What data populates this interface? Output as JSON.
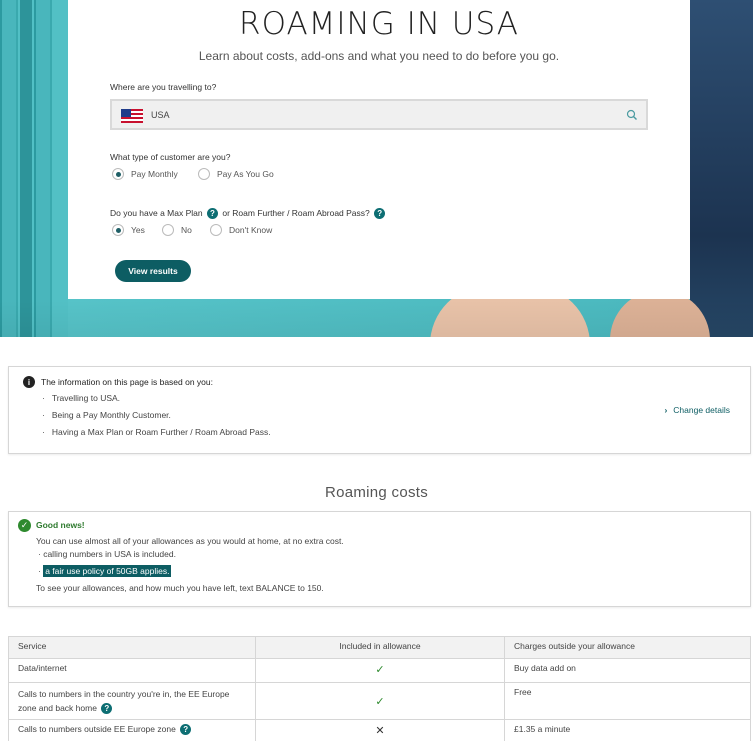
{
  "header": {
    "title": "ROAMING IN USA",
    "subtitle": "Learn about costs, add-ons and what you need to do before you go."
  },
  "form": {
    "destination_question": "Where are you travelling to?",
    "destination_value": "USA",
    "customer_question": "What type of customer are you?",
    "customer_options": [
      "Pay Monthly",
      "Pay As You Go"
    ],
    "customer_selected": "Pay Monthly",
    "plan_question_part1": "Do you have a Max Plan",
    "plan_question_part2": "or Roam Further / Roam Abroad Pass?",
    "plan_options": [
      "Yes",
      "No",
      "Don't Know"
    ],
    "plan_selected": "Yes",
    "view_results": "View results"
  },
  "info": {
    "heading": "The information on this page is based on you:",
    "items": [
      "Travelling to USA.",
      "Being a Pay Monthly Customer.",
      "Having a Max Plan or Roam Further / Roam Abroad Pass."
    ],
    "change_details": "Change details"
  },
  "roaming": {
    "title": "Roaming costs",
    "good_news": "Good news!",
    "line1": "You can use almost all of your allowances as you would at home, at no extra cost.",
    "bullet1": "calling numbers in USA is included.",
    "bullet2": "a fair use policy of 50GB applies.",
    "line2": "To see your allowances, and how much you have left, text BALANCE to 150."
  },
  "table": {
    "headers": [
      "Service",
      "Included in allowance",
      "Charges outside your allowance"
    ],
    "rows": [
      {
        "service": "Data/internet",
        "included": "✓",
        "charge": "Buy data add on"
      },
      {
        "service": "Calls to numbers in the country you're in, the EE Europe zone and back home",
        "included": "✓",
        "charge": "Free"
      },
      {
        "service": "Calls to numbers outside EE Europe zone",
        "included": "✕",
        "charge": "£1.35 a minute"
      }
    ]
  },
  "colors": {
    "accent": "#0d5d63",
    "good": "#2e8a2e"
  }
}
